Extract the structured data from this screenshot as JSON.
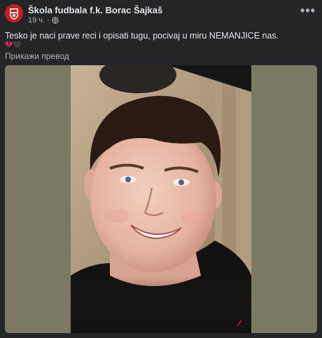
{
  "post": {
    "page_name": "Škola fudbala f.k. Borac Šajkaš",
    "time": "19 ч.",
    "separator": "·",
    "privacy_icon": "globe-icon",
    "more_icon": "more-horizontal-icon",
    "more_label": "•••",
    "text": "Tesko je naci prave reci i opisati tugu, pocivaj u miru NEMANJICE nas.",
    "emojis": [
      "broken-heart-icon",
      "black-heart-icon"
    ],
    "translate_label": "Прикажи превод"
  },
  "colors": {
    "background": "#242526",
    "text_primary": "#e4e6eb",
    "text_secondary": "#b0b3b8",
    "photo_border": "#7b7962",
    "avatar_red": "#c41e22"
  }
}
